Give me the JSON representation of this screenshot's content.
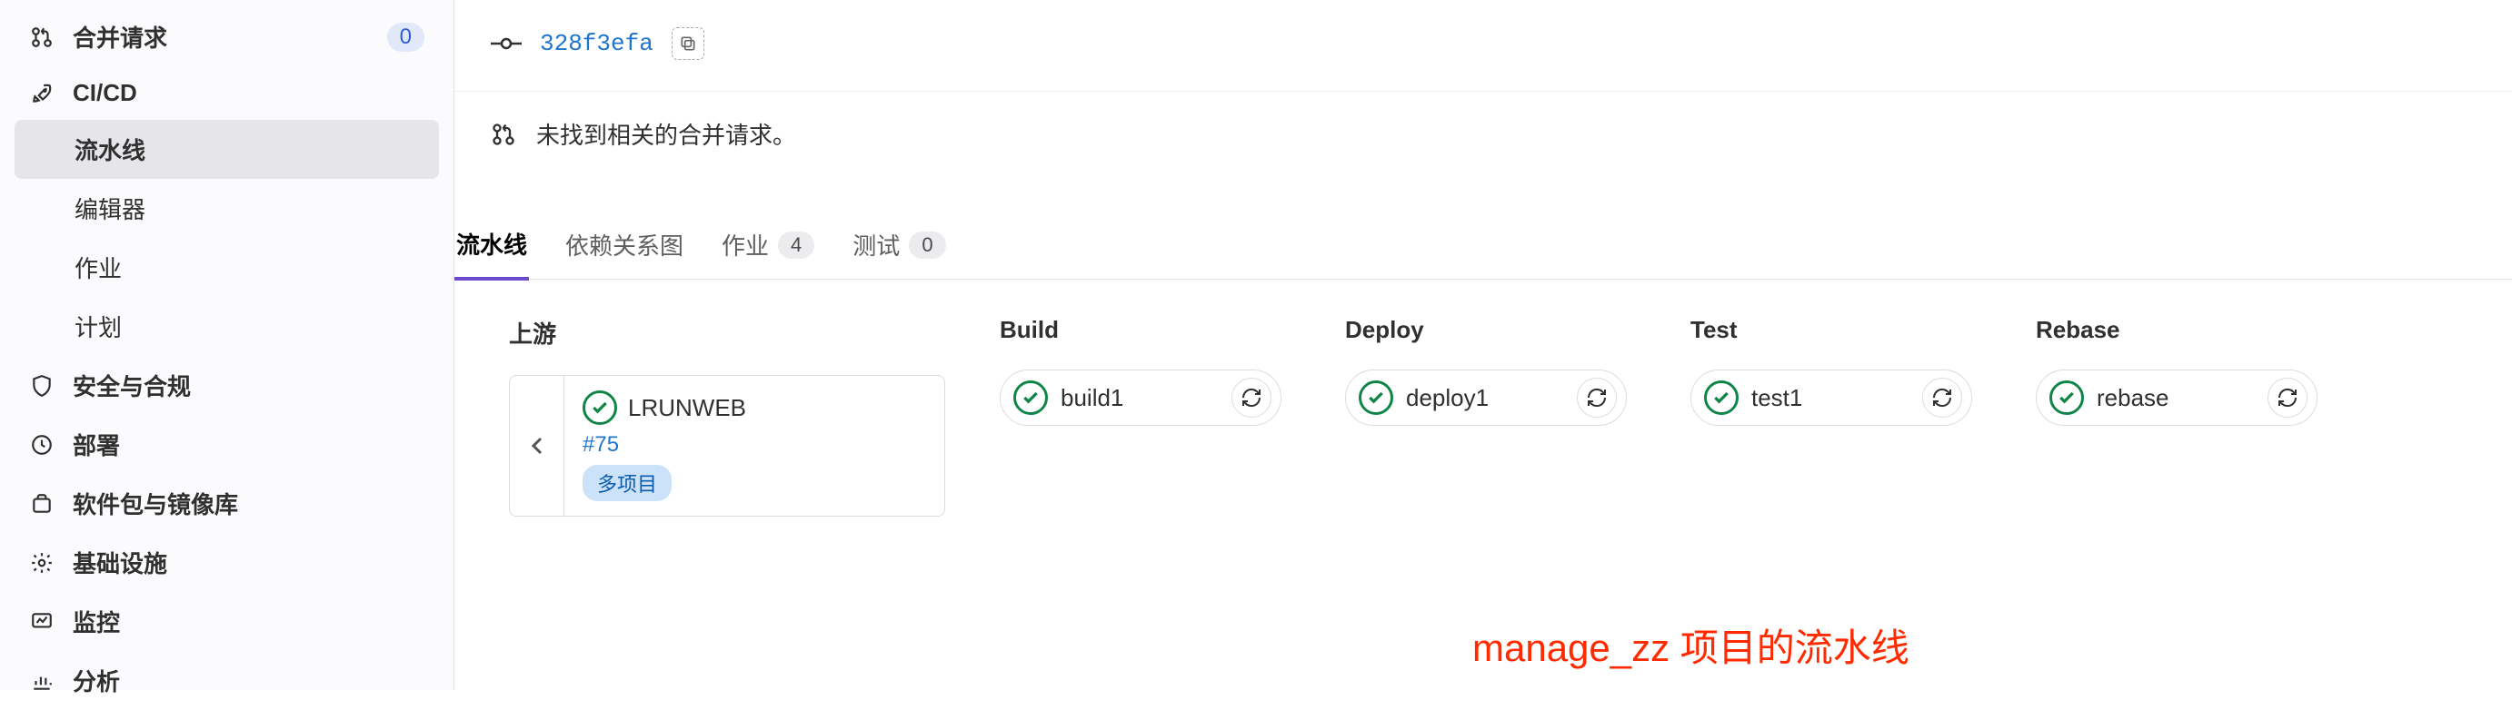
{
  "sidebar": {
    "mr": {
      "label": "合并请求",
      "count": "0"
    },
    "cicd": {
      "label": "CI/CD"
    },
    "sub": {
      "pipelines": "流水线",
      "editor": "编辑器",
      "jobs": "作业",
      "schedules": "计划"
    },
    "security": "安全与合规",
    "deploy": "部署",
    "packages": "软件包与镜像库",
    "infra": "基础设施",
    "monitor": "监控",
    "analyze": "分析"
  },
  "commit": {
    "hash": "328f3efa"
  },
  "mr_empty": "未找到相关的合并请求。",
  "tabs": {
    "pipeline": "流水线",
    "deps": "依赖关系图",
    "jobs": {
      "label": "作业",
      "count": "4"
    },
    "tests": {
      "label": "测试",
      "count": "0"
    }
  },
  "stages": {
    "upstream": {
      "title": "上游",
      "project": "LRUNWEB",
      "id": "#75",
      "tag": "多项目"
    },
    "build": {
      "title": "Build",
      "job": "build1"
    },
    "deploy": {
      "title": "Deploy",
      "job": "deploy1"
    },
    "test": {
      "title": "Test",
      "job": "test1"
    },
    "rebase": {
      "title": "Rebase",
      "job": "rebase"
    }
  },
  "annotation": "manage_zz 项目的流水线"
}
